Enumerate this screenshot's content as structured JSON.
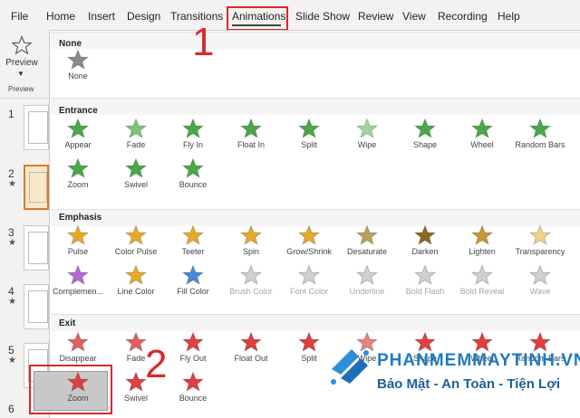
{
  "ribbon": {
    "tabs": [
      {
        "label": "File"
      },
      {
        "label": "Home"
      },
      {
        "label": "Insert"
      },
      {
        "label": "Design"
      },
      {
        "label": "Transitions"
      },
      {
        "label": "Animations",
        "active": true
      },
      {
        "label": "Slide Show"
      },
      {
        "label": "Review"
      },
      {
        "label": "View"
      },
      {
        "label": "Recording"
      },
      {
        "label": "Help"
      }
    ],
    "preview_label": "Preview",
    "preview_group_label": "Preview"
  },
  "slides": [
    {
      "number": "1",
      "has_animation": false
    },
    {
      "number": "2",
      "has_animation": true,
      "active": true
    },
    {
      "number": "3",
      "has_animation": true
    },
    {
      "number": "4",
      "has_animation": true
    },
    {
      "number": "5",
      "has_animation": true
    },
    {
      "number": "6",
      "has_animation": false
    }
  ],
  "gallery": {
    "sections": [
      {
        "title": "None",
        "effects": [
          {
            "label": "None",
            "color": "#8a8a8a"
          }
        ]
      },
      {
        "title": "Entrance",
        "effects": [
          {
            "label": "Appear",
            "color": "#4aa84a"
          },
          {
            "label": "Fade",
            "color": "#7cc47c"
          },
          {
            "label": "Fly In",
            "color": "#4aa84a"
          },
          {
            "label": "Float In",
            "color": "#4aa84a"
          },
          {
            "label": "Split",
            "color": "#4aa84a"
          },
          {
            "label": "Wipe",
            "color": "#9fd49f"
          },
          {
            "label": "Shape",
            "color": "#4aa84a"
          },
          {
            "label": "Wheel",
            "color": "#4aa84a"
          },
          {
            "label": "Random Bars",
            "color": "#4aa84a"
          },
          {
            "label": "Zoom",
            "color": "#4aa84a"
          },
          {
            "label": "Swivel",
            "color": "#4aa84a"
          },
          {
            "label": "Bounce",
            "color": "#4aa84a"
          }
        ]
      },
      {
        "title": "Emphasis",
        "effects": [
          {
            "label": "Pulse",
            "color": "#e8a92b"
          },
          {
            "label": "Color Pulse",
            "color": "#e8a92b"
          },
          {
            "label": "Teeter",
            "color": "#e8a92b"
          },
          {
            "label": "Spin",
            "color": "#e8a92b"
          },
          {
            "label": "Grow/Shrink",
            "color": "#e8a92b"
          },
          {
            "label": "Desaturate",
            "color": "#b8a060"
          },
          {
            "label": "Darken",
            "color": "#8a6a20"
          },
          {
            "label": "Lighten",
            "color": "#c89a30"
          },
          {
            "label": "Transparency",
            "color": "#f0d08a"
          },
          {
            "label": "Complemen...",
            "color": "#b46ad0"
          },
          {
            "label": "Line Color",
            "color": "#e8a92b"
          },
          {
            "label": "Fill Color",
            "color": "#4a8ad8"
          },
          {
            "label": "Brush Color",
            "color": "#d0d0d0",
            "disabled": true
          },
          {
            "label": "Font Color",
            "color": "#d0d0d0",
            "disabled": true
          },
          {
            "label": "Underline",
            "color": "#d0d0d0",
            "disabled": true
          },
          {
            "label": "Bold Flash",
            "color": "#d0d0d0",
            "disabled": true
          },
          {
            "label": "Bold Reveal",
            "color": "#d0d0d0",
            "disabled": true
          },
          {
            "label": "Wave",
            "color": "#d0d0d0",
            "disabled": true
          }
        ]
      },
      {
        "title": "Exit",
        "effects": [
          {
            "label": "Disappear",
            "color": "#e06060"
          },
          {
            "label": "Fade",
            "color": "#e06060"
          },
          {
            "label": "Fly Out",
            "color": "#e04040"
          },
          {
            "label": "Float Out",
            "color": "#e04040"
          },
          {
            "label": "Split",
            "color": "#e04040"
          },
          {
            "label": "Wipe",
            "color": "#e88080"
          },
          {
            "label": "Shape",
            "color": "#e04040"
          },
          {
            "label": "Wheel",
            "color": "#e04040"
          },
          {
            "label": "Random Bars",
            "color": "#e04040"
          },
          {
            "label": "Zoom",
            "color": "#e04040",
            "selected": true
          },
          {
            "label": "Swivel",
            "color": "#e04040"
          },
          {
            "label": "Bounce",
            "color": "#e04040"
          }
        ]
      }
    ]
  },
  "annotations": {
    "callout_1": "1",
    "callout_2": "2"
  },
  "watermark": {
    "title": "PHANMEMMAYTINH.VN",
    "subtitle": "Bảo Mật - An Toàn - Tiện Lợi"
  }
}
